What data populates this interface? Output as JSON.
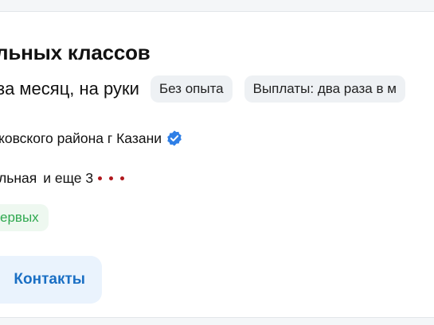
{
  "vacancy": {
    "title": "льных классов",
    "salary": "за месяц, на руки",
    "chips": [
      "Без опыта",
      "Выплаты: два раза в м"
    ],
    "company": "ковского района г Казани",
    "company_verified": true,
    "metro": "льная",
    "more_stations": "и еще 3",
    "metro_dot_color": "#b0181d",
    "tag": "ервых",
    "contacts_button": "Контакты"
  },
  "colors": {
    "accent_blue": "#1a6fc4",
    "verified_blue": "#2f7fe6",
    "green_tag_text": "#2fa84f",
    "green_tag_bg": "#eef8f0",
    "chip_bg": "#eef1f4"
  }
}
